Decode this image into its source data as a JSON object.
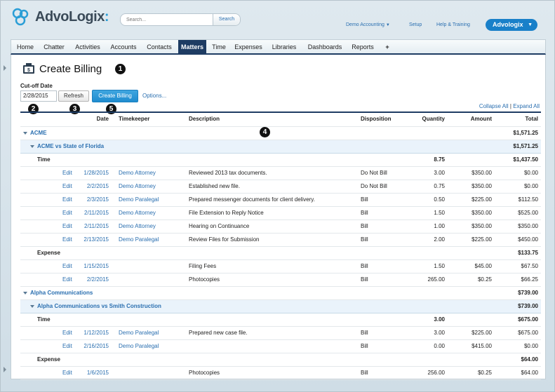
{
  "header": {
    "brand": "AdvoLogix",
    "brand_suffix": ":",
    "search_placeholder": "Search...",
    "search_button": "Search",
    "org_menu": "Demo Accounting",
    "setup": "Setup",
    "help": "Help & Training",
    "app_button": "Advologix"
  },
  "tabs": [
    "Home",
    "Chatter",
    "Activities",
    "Accounts",
    "Contacts",
    "Matters",
    "Time",
    "Expenses",
    "Libraries",
    "Dashboards",
    "Reports",
    "+"
  ],
  "active_tab": "Matters",
  "page": {
    "title": "Create Billing",
    "cutoff_label": "Cut-off Date",
    "cutoff_value": "2/28/2015",
    "refresh_button": "Refresh",
    "create_button": "Create Billing",
    "options_link": "Options...",
    "collapse_all": "Collapse All",
    "separator": "|",
    "expand_all": "Expand All"
  },
  "callouts": [
    "1",
    "2",
    "3",
    "4",
    "5"
  ],
  "columns": {
    "date": "Date",
    "timekeeper": "Timekeeper",
    "description": "Description",
    "disposition": "Disposition",
    "quantity": "Quantity",
    "amount": "Amount",
    "total": "Total"
  },
  "rows": [
    {
      "kind": "client",
      "label": "ACME",
      "total": "$1,571.25"
    },
    {
      "kind": "matter",
      "label": "ACME vs State of Florida",
      "total": "$1,571.25"
    },
    {
      "kind": "section",
      "label": "Time",
      "quantity": "8.75",
      "total": "$1,437.50"
    },
    {
      "kind": "entry",
      "action": "Edit",
      "date": "1/28/2015",
      "timekeeper": "Demo Attorney",
      "description": "Reviewed 2013 tax documents.",
      "disposition": "Do Not Bill",
      "quantity": "3.00",
      "amount": "$350.00",
      "total": "$0.00"
    },
    {
      "kind": "entry",
      "action": "Edit",
      "date": "2/2/2015",
      "timekeeper": "Demo Attorney",
      "description": "Established new file.",
      "disposition": "Do Not Bill",
      "quantity": "0.75",
      "amount": "$350.00",
      "total": "$0.00"
    },
    {
      "kind": "entry",
      "action": "Edit",
      "date": "2/3/2015",
      "timekeeper": "Demo Paralegal",
      "description": "Prepared messenger documents for client delivery.",
      "disposition": "Bill",
      "quantity": "0.50",
      "amount": "$225.00",
      "total": "$112.50"
    },
    {
      "kind": "entry",
      "action": "Edit",
      "date": "2/11/2015",
      "timekeeper": "Demo Attorney",
      "description": "File Extension to Reply Notice",
      "disposition": "Bill",
      "quantity": "1.50",
      "amount": "$350.00",
      "total": "$525.00"
    },
    {
      "kind": "entry",
      "action": "Edit",
      "date": "2/11/2015",
      "timekeeper": "Demo Attorney",
      "description": "Hearing on Continuance",
      "disposition": "Bill",
      "quantity": "1.00",
      "amount": "$350.00",
      "total": "$350.00"
    },
    {
      "kind": "entry",
      "action": "Edit",
      "date": "2/13/2015",
      "timekeeper": "Demo Paralegal",
      "description": "Review Files for Submission",
      "disposition": "Bill",
      "quantity": "2.00",
      "amount": "$225.00",
      "total": "$450.00"
    },
    {
      "kind": "section",
      "label": "Expense",
      "quantity": "",
      "total": "$133.75"
    },
    {
      "kind": "entry",
      "action": "Edit",
      "date": "1/15/2015",
      "timekeeper": "",
      "description": "Filing Fees",
      "disposition": "Bill",
      "quantity": "1.50",
      "amount": "$45.00",
      "total": "$67.50"
    },
    {
      "kind": "entry",
      "action": "Edit",
      "date": "2/2/2015",
      "timekeeper": "",
      "description": "Photocopies",
      "disposition": "Bill",
      "quantity": "265.00",
      "amount": "$0.25",
      "total": "$66.25"
    },
    {
      "kind": "client",
      "label": "Alpha Communications",
      "total": "$739.00"
    },
    {
      "kind": "matter",
      "label": "Alpha Communications vs Smith Construction",
      "total": "$739.00"
    },
    {
      "kind": "section",
      "label": "Time",
      "quantity": "3.00",
      "total": "$675.00"
    },
    {
      "kind": "entry",
      "action": "Edit",
      "date": "1/12/2015",
      "timekeeper": "Demo Paralegal",
      "description": "Prepared new case file.",
      "disposition": "Bill",
      "quantity": "3.00",
      "amount": "$225.00",
      "total": "$675.00"
    },
    {
      "kind": "entry",
      "action": "Edit",
      "date": "2/16/2015",
      "timekeeper": "Demo Paralegal",
      "description": "",
      "disposition": "Bill",
      "quantity": "0.00",
      "amount": "$415.00",
      "total": "$0.00"
    },
    {
      "kind": "section",
      "label": "Expense",
      "quantity": "",
      "total": "$64.00"
    },
    {
      "kind": "entry",
      "action": "Edit",
      "date": "1/6/2015",
      "timekeeper": "",
      "description": "Photocopies",
      "disposition": "Bill",
      "quantity": "256.00",
      "amount": "$0.25",
      "total": "$64.00"
    }
  ],
  "colors": {
    "accent": "#1e3c63",
    "link": "#2a6fb0",
    "primary_button": "#1f8ccf",
    "matter_row": "#eaf3fb"
  }
}
